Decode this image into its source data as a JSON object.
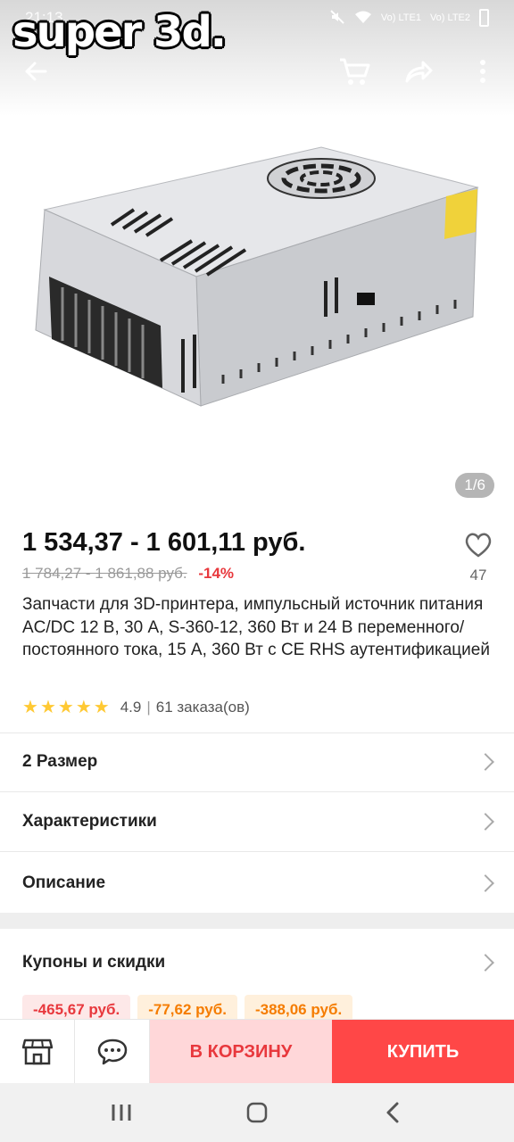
{
  "status_bar": {
    "time": "21:13",
    "sim1": "Vo) LTE1",
    "sim2": "Vo) LTE2"
  },
  "watermark": "super 3d.",
  "toolbar": {
    "back_icon": "arrow-left-icon",
    "cart_icon": "cart-icon",
    "share_icon": "share-icon",
    "more_icon": "more-vertical-icon"
  },
  "gallery": {
    "indicator": "1/6"
  },
  "product": {
    "price_range": "1 534,37 - 1 601,11 руб.",
    "old_price_range": "1 784,27 - 1 861,88 руб.",
    "discount": "-14%",
    "wishlist_count": "47",
    "title": "Запчасти для 3D-принтера, импульсный источник питания AC/DC 12 В, 30 А, S-360-12, 360 Вт и 24 В переменного/постоянного тока, 15 А, 360 Вт с CE RHS аутентификацией",
    "rating": "4.9",
    "rating_stars": 5,
    "orders": "61 заказа(ов)"
  },
  "rows": {
    "size": "2 Размер",
    "specs": "Характеристики",
    "description": "Описание",
    "coupons": "Купоны и скидки"
  },
  "coupons": [
    "-465,67 руб.",
    "-77,62 руб.",
    "-388,06 руб."
  ],
  "actions": {
    "add_to_cart": "В КОРЗИНУ",
    "buy": "КУПИТЬ"
  },
  "colors": {
    "accent": "#ff4747",
    "discount": "#e8383d",
    "star": "#ffc933"
  }
}
